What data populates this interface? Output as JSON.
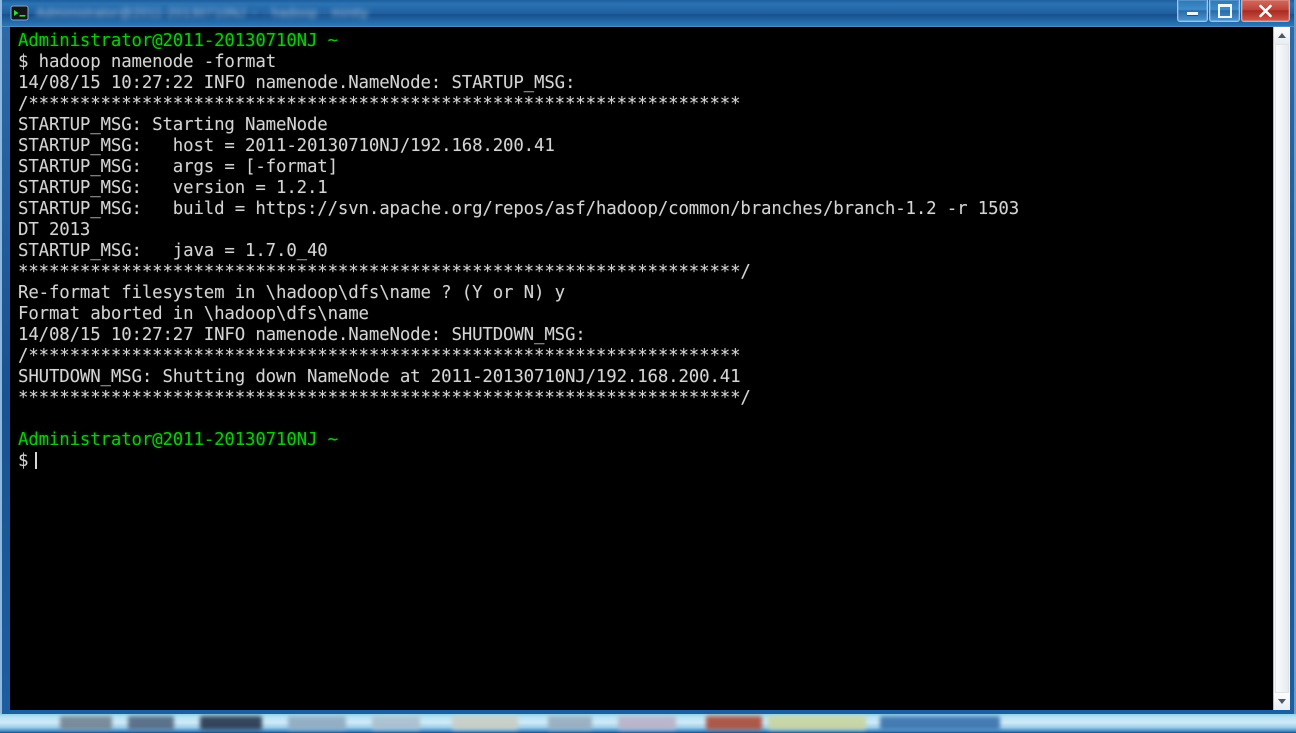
{
  "window": {
    "title_blurred": "Administrator@2011-20130710NJ ~  -  hadoop  -  mintty",
    "icon": "terminal-icon",
    "controls": {
      "minimize_label": "Minimize",
      "maximize_label": "Maximize",
      "close_label": "Close"
    }
  },
  "taskbar": {
    "present": true
  },
  "terminal": {
    "prompt_line_1": "Administrator@2011-20130710NJ ~",
    "prompt_line_2_symbol": "$",
    "command": " hadoop namenode -format",
    "lines": [
      "14/08/15 10:27:22 INFO namenode.NameNode: STARTUP_MSG:",
      "/*********************************************************************",
      "STARTUP_MSG: Starting NameNode",
      "STARTUP_MSG:   host = 2011-20130710NJ/192.168.200.41",
      "STARTUP_MSG:   args = [-format]",
      "STARTUP_MSG:   version = 1.2.1",
      "STARTUP_MSG:   build = https://svn.apache.org/repos/asf/hadoop/common/branches/branch-1.2 -r 1503",
      "DT 2013",
      "STARTUP_MSG:   java = 1.7.0_40",
      "**********************************************************************/",
      "Re-format filesystem in \\hadoop\\dfs\\name ? (Y or N) y",
      "Format aborted in \\hadoop\\dfs\\name",
      "14/08/15 10:27:27 INFO namenode.NameNode: SHUTDOWN_MSG:",
      "/*********************************************************************",
      "SHUTDOWN_MSG: Shutting down NameNode at 2011-20130710NJ/192.168.200.41",
      "**********************************************************************/"
    ],
    "final_prompt_line_1": "Administrator@2011-20130710NJ ~",
    "final_prompt_symbol": "$",
    "cursor_visible": true,
    "colors": {
      "background": "#000000",
      "foreground": "#d4d4d4",
      "prompt_green": "#13c613"
    }
  },
  "scrollbar": {
    "up_arrow": "scroll-up-arrow",
    "down_arrow": "scroll-down-arrow",
    "thumb_position": "full"
  }
}
